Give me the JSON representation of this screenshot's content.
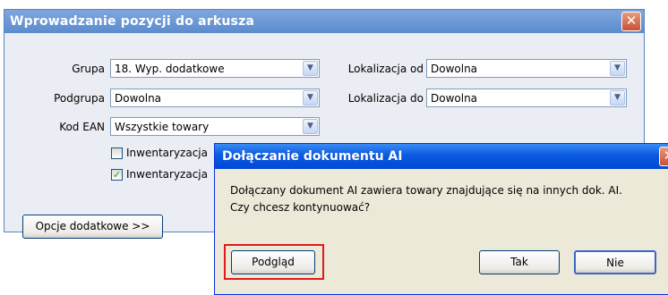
{
  "main_window": {
    "title": "Wprowadzanie pozycji do arkusza",
    "close_glyph": "✕",
    "group_label": "Grupa",
    "group_value": "18. Wyp. dodatkowe",
    "subgroup_label": "Podgrupa",
    "subgroup_value": "Dowolna",
    "ean_label": "Kod EAN",
    "ean_value": "Wszystkie towary",
    "location_from_label": "Lokalizacja od",
    "location_from_value": "Dowolna",
    "location_to_label": "Lokalizacja do",
    "location_to_value": "Dowolna",
    "checkbox1_label": "Inwentaryzacja",
    "checkbox1_checked": false,
    "checkbox2_label": "Inwentaryzacja",
    "checkbox2_checked": true,
    "options_button": "Opcje dodatkowe >>"
  },
  "dialog": {
    "title": "Dołączanie dokumentu AI",
    "close_glyph": "✕",
    "message_line1": "Dołączany dokument AI zawiera towary znajdujące się na innych dok. AI.",
    "message_line2": "Czy chcesz kontynuować?",
    "preview_button": "Podgląd",
    "yes_button": "Tak",
    "no_button": "Nie"
  },
  "icons": {
    "dropdown_arrow": "▼",
    "checkmark": "✓"
  },
  "colors": {
    "main_titlebar": "#6b98d6",
    "dialog_titlebar": "#0a5ae0",
    "highlight_box": "#e01a1a"
  }
}
